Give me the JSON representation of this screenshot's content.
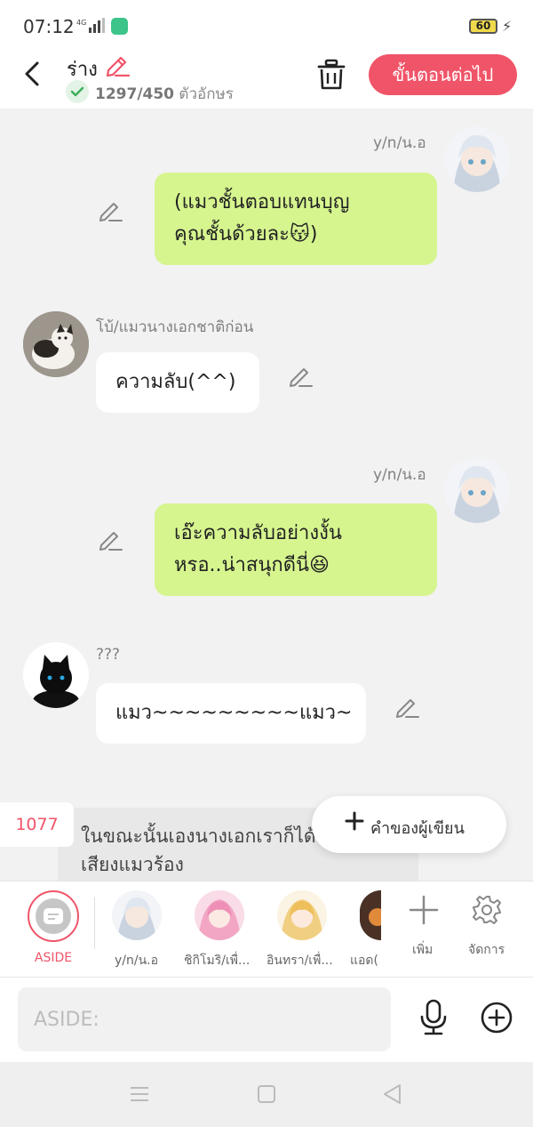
{
  "status_bar": {
    "time": "07:12",
    "network": "4G",
    "battery": "60"
  },
  "header": {
    "title": "ร่าง",
    "char_count": "1297/450",
    "char_unit": "ตัวอักษร",
    "next_button": "ขั้นตอนต่อไป"
  },
  "messages": [
    {
      "sender": "y/n/น.อ",
      "side": "right",
      "text_lines": [
        "(แมวชั้นตอบแทนบุญ",
        "คุณชั้นด้วยละ😽)"
      ]
    },
    {
      "sender": "โบ้/แมวนางเอกชาติก่อน",
      "side": "left",
      "text_lines": [
        "ความลับ(^^)"
      ]
    },
    {
      "sender": "y/n/น.อ",
      "side": "right",
      "text_lines": [
        "เอ๊ะความลับอย่างงั้น",
        "หรอ..น่าสนุกดีนี่😆"
      ]
    },
    {
      "sender": "???",
      "side": "left",
      "text_lines": [
        "แมว~~~~~~~~~แมว~"
      ]
    }
  ],
  "narration": {
    "counter": "1077",
    "line1": "ในขณะนั้นเองนางเอกเราก็ได้",
    "line2": "เสียงแมวร้อง"
  },
  "author_note_button": "คำของผู้เขียน",
  "characters": {
    "aside_label": "ASIDE",
    "items": [
      {
        "label": "y/n/น.อ"
      },
      {
        "label": "ชิกิโมริ/เพื่..."
      },
      {
        "label": "อินทรา/เพื่..."
      },
      {
        "label": "แอด("
      }
    ],
    "add_label": "เพิ่ม",
    "manage_label": "จัดการ"
  },
  "composer": {
    "placeholder": "ASIDE:"
  },
  "colors": {
    "accent": "#f05468",
    "bubble_self": "#d6f58f",
    "bubble_other": "#ffffff",
    "chat_bg": "#f2f2f2"
  }
}
